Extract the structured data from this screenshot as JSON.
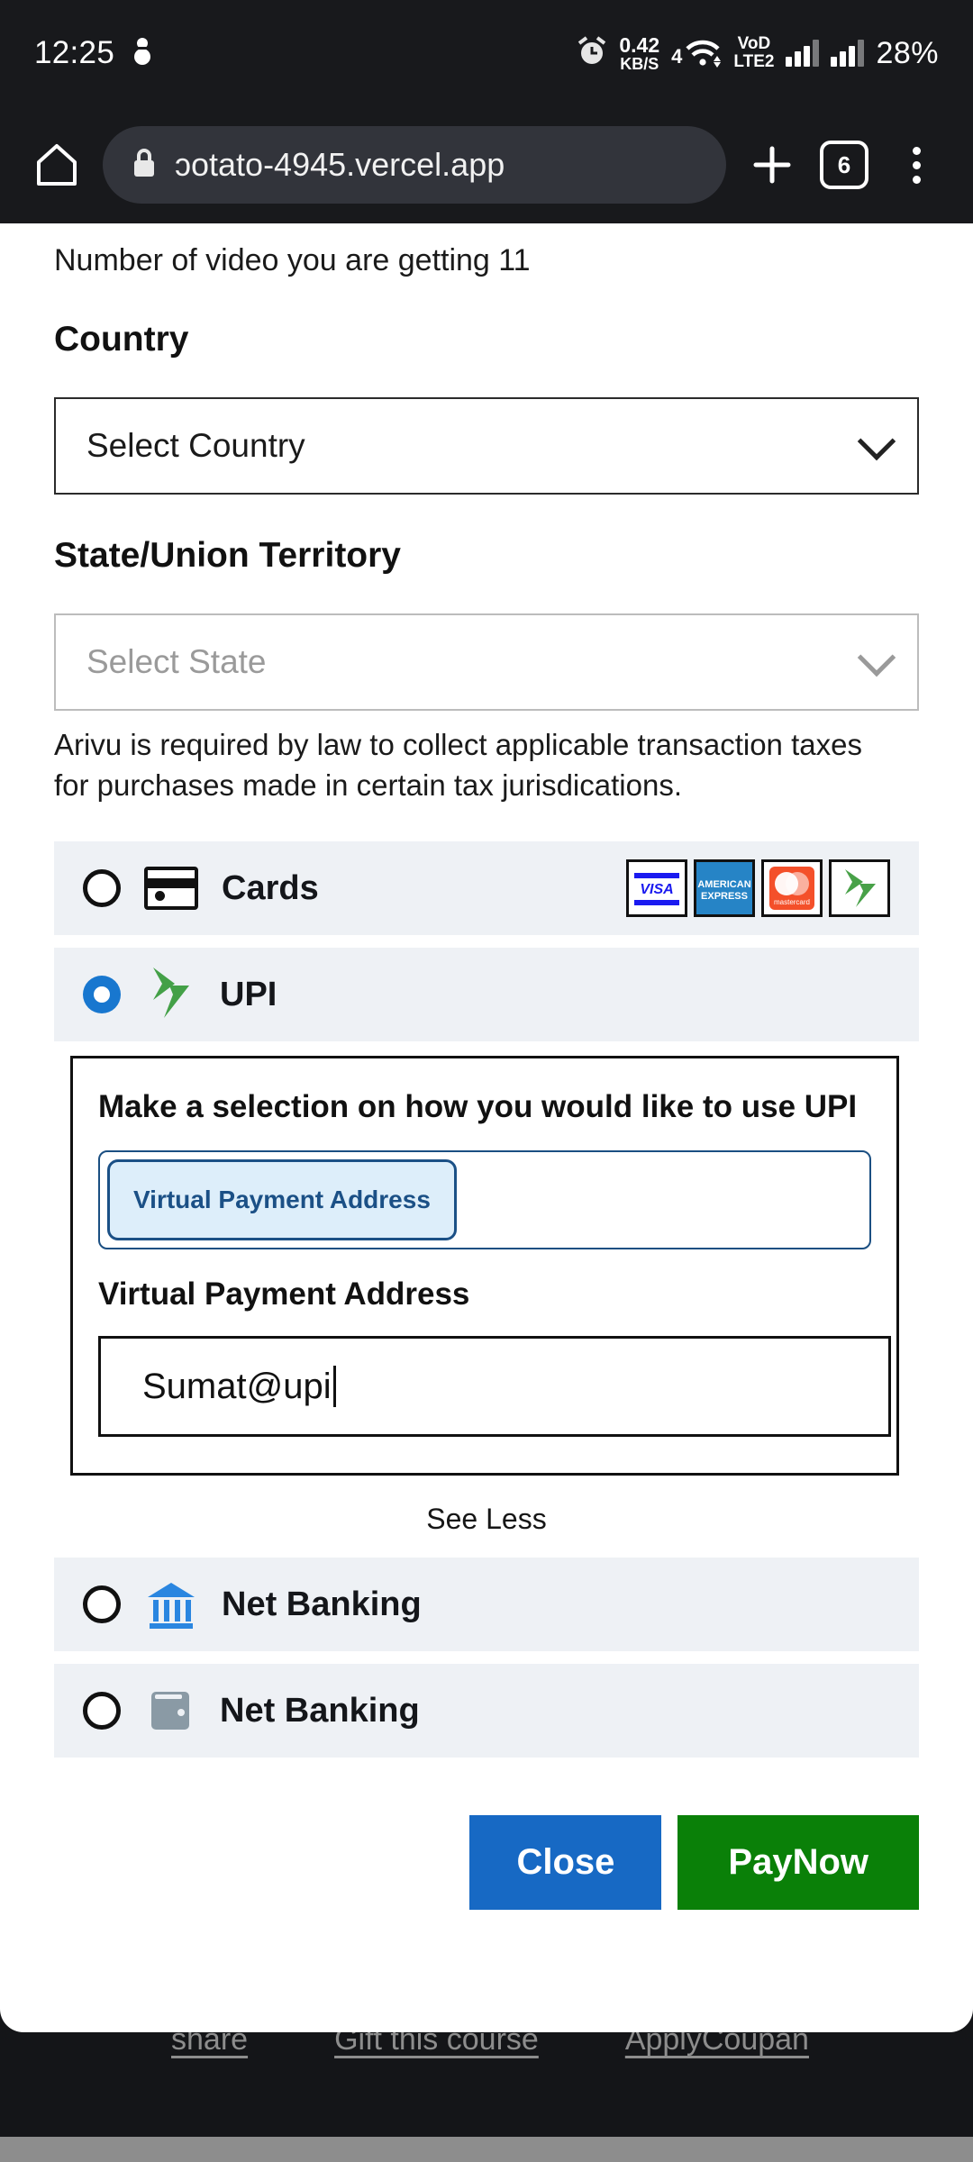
{
  "statusbar": {
    "time": "12:25",
    "net_speed_value": "0.42",
    "net_speed_unit": "KB/S",
    "wifi_label": "4",
    "volte_line1": "VoD",
    "volte_line2": "LTE2",
    "battery": "28%"
  },
  "browser": {
    "url": "ɔotato-4945.vercel.app",
    "tab_count": "6"
  },
  "background_page": {
    "links": [
      "share",
      "Gift this course",
      "ApplyCoupan"
    ]
  },
  "modal": {
    "video_count_text": "Number of video you are getting 11",
    "country": {
      "label": "Country",
      "value": "Select Country"
    },
    "state": {
      "label": "State/Union Territory",
      "placeholder": "Select State"
    },
    "tax_notice": "Arivu is required by law to collect applicable transaction taxes for purchases made in certain tax jurisdications.",
    "payment_methods": [
      {
        "name": "Cards",
        "selected": false,
        "icon": "credit-card-icon"
      },
      {
        "name": "UPI",
        "selected": true,
        "icon": "upi-logo-icon"
      },
      {
        "name": "Net Banking",
        "selected": false,
        "icon": "bank-icon"
      },
      {
        "name": "Net Banking",
        "selected": false,
        "icon": "wallet-icon"
      }
    ],
    "card_networks": [
      "VISA",
      "AMERICAN EXPRESS",
      "mastercard",
      "rupay"
    ],
    "upi": {
      "heading": "Make a selection on how you would like to use UPI",
      "tab_label": "Virtual Payment Address",
      "field_label": "Virtual Payment Address",
      "vpa_value": "Sumat@upi",
      "see_less": "See Less"
    },
    "buttons": {
      "close": "Close",
      "pay": "PayNow"
    }
  },
  "colors": {
    "accent_blue": "#1769c4",
    "pay_green": "#0a8008",
    "row_bg": "#eef1f5",
    "upi_green": "#43a047",
    "chip_blue": "#1b5086"
  }
}
